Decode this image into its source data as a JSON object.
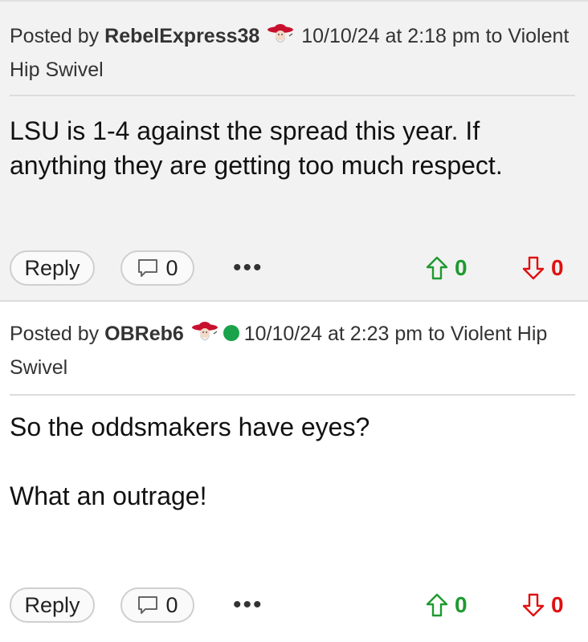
{
  "colors": {
    "upvote": "#1e9a2e",
    "downvote": "#e01010",
    "online": "#1aa34a",
    "post_bg_alt": "#f2f2f2"
  },
  "posts": [
    {
      "posted_by_prefix": "Posted by",
      "username": "RebelExpress38",
      "team_icon": "ole-miss-cowboy-icon",
      "meta": "10/10/24 at 2:18 pm to Violent Hip Swivel",
      "body": [
        "LSU is 1-4 against the spread this year. If anything they are getting too much respect."
      ],
      "reply_label": "Reply",
      "comment_count": "0",
      "more_label": "•••",
      "upvotes": "0",
      "downvotes": "0"
    },
    {
      "posted_by_prefix": "Posted by",
      "username": "OBReb6",
      "team_icon": "ole-miss-cowboy-icon",
      "online": true,
      "meta": "10/10/24 at 2:23 pm to Violent Hip Swivel",
      "body": [
        "So the oddsmakers have eyes?",
        "What an outrage!"
      ],
      "reply_label": "Reply",
      "comment_count": "0",
      "more_label": "•••",
      "upvotes": "0",
      "downvotes": "0"
    }
  ]
}
